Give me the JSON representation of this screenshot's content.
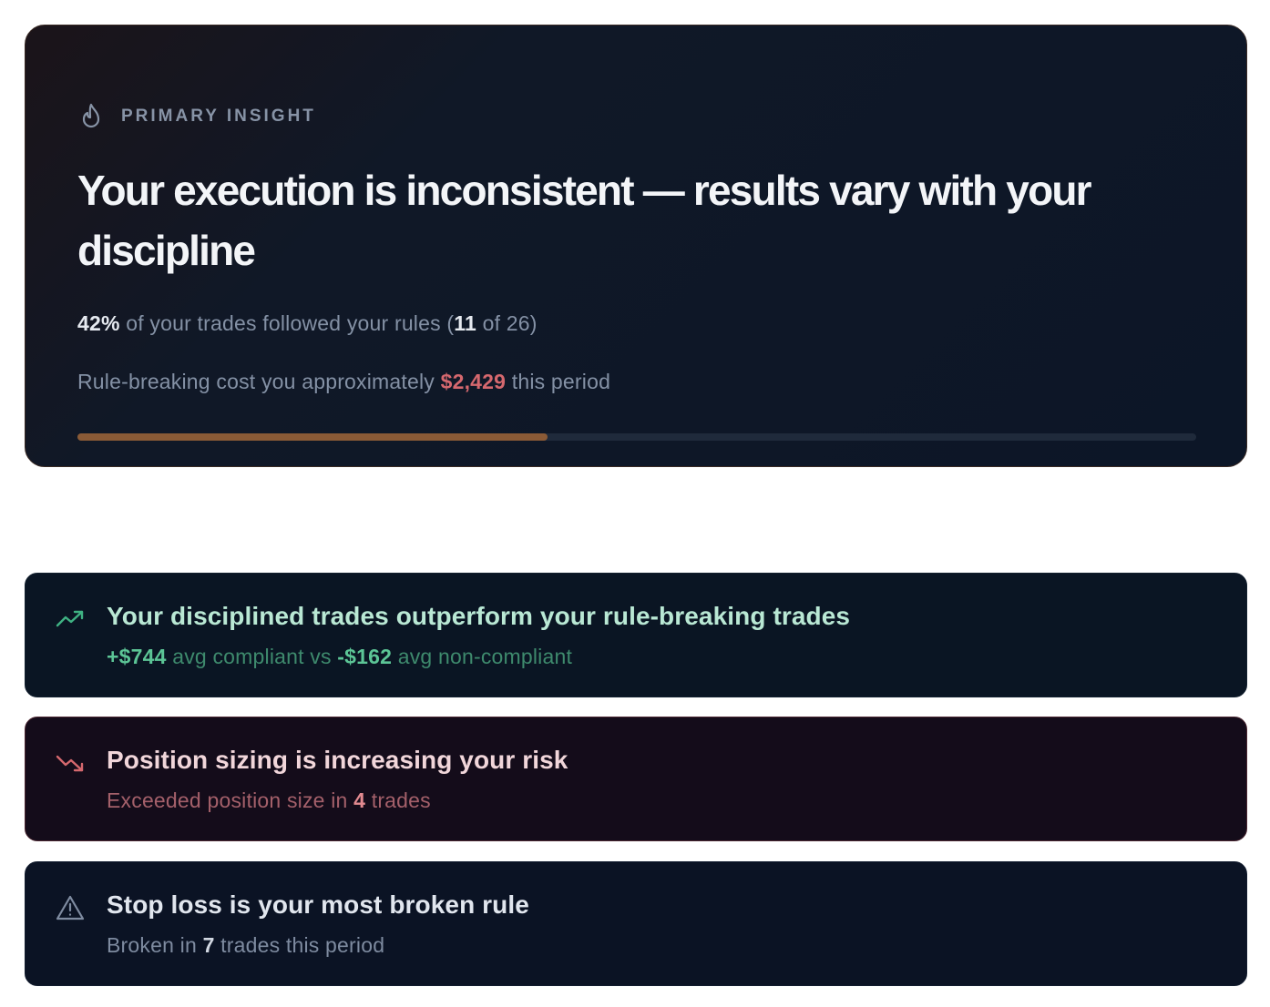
{
  "primary": {
    "eyebrow": "PRIMARY INSIGHT",
    "icon": "flame-icon",
    "headline": "Your execution is inconsistent — results vary with your discipline",
    "compliance_pct": "42%",
    "compliance_text": " of your trades followed your rules (",
    "compliant_count": "11",
    "total_text": " of 26)",
    "cost_prefix": "Rule-breaking cost you approximately ",
    "cost_value": "$2,429",
    "cost_suffix": " this period",
    "progress_fraction": 0.42,
    "accent_color": "#8a5a36"
  },
  "insights": {
    "discipline": {
      "icon": "trending-up-icon",
      "title": "Your disciplined trades outperform your rule-breaking trades",
      "compliant_value": "+$744",
      "compliant_label": " avg compliant vs ",
      "noncompliant_value": "-$162",
      "noncompliant_label": " avg non-compliant"
    },
    "sizing": {
      "icon": "trending-down-icon",
      "title": "Position sizing is increasing your risk",
      "prefix": "Exceeded position size in ",
      "count": "4",
      "suffix": " trades"
    },
    "stoploss": {
      "icon": "warning-triangle-icon",
      "title": "Stop loss is your most broken rule",
      "prefix": "Broken in ",
      "count": "7",
      "suffix": " trades this period"
    }
  }
}
